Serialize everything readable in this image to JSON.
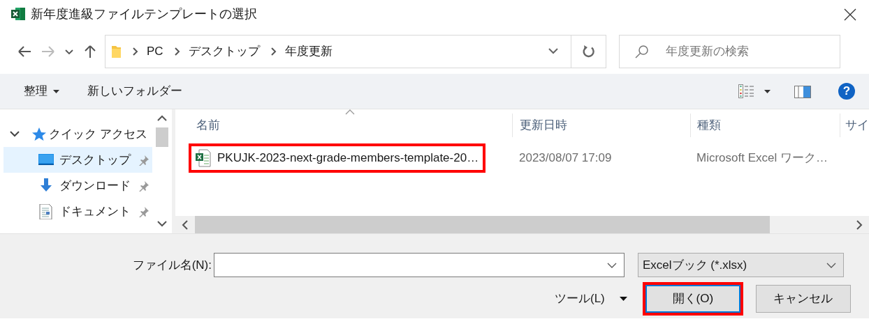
{
  "window": {
    "title": "新年度進級ファイルテンプレートの選択"
  },
  "address": {
    "path": [
      "PC",
      "デスクトップ",
      "年度更新"
    ]
  },
  "search": {
    "placeholder": "年度更新の検索"
  },
  "toolbar": {
    "items": [
      {
        "label": "整理",
        "kind": "menu"
      },
      {
        "label": "新しいフォルダー",
        "kind": "button"
      }
    ],
    "help_label": "?"
  },
  "sidebar": {
    "items": [
      {
        "label": "クイック アクセス",
        "kind": "group",
        "expanded": true,
        "selected": false,
        "children": [
          {
            "label": "デスクトップ",
            "kind": "desktop",
            "selected": true
          },
          {
            "label": "ダウンロード",
            "kind": "download",
            "selected": false
          },
          {
            "label": "ドキュメント",
            "kind": "document",
            "selected": false
          }
        ]
      }
    ]
  },
  "file_list": {
    "columns": [
      "名前",
      "更新日時",
      "種類",
      "サイ"
    ],
    "rows": [
      {
        "name": "PKUJK-2023-next-grade-members-template-20…",
        "modified": "2023/08/07 17:09",
        "type": "Microsoft Excel ワーク…",
        "highlighted": true
      }
    ]
  },
  "footer": {
    "filename_label": "ファイル名(N):",
    "filter": "Excelブック (*.xlsx)",
    "tools": "ツール(L)",
    "buttons": [
      {
        "label": "開く(O)",
        "kind": "primary",
        "highlighted": true
      },
      {
        "label": "キャンセル",
        "kind": "normal",
        "highlighted": false
      }
    ]
  }
}
